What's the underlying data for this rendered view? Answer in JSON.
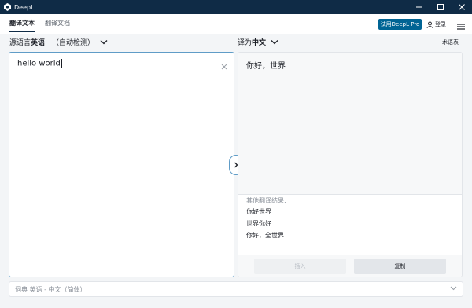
{
  "window": {
    "title": "DeepL",
    "controls": [
      "minimize-icon",
      "maximize-icon",
      "close-icon"
    ]
  },
  "tabs": [
    {
      "label": "翻译文本",
      "active": true
    },
    {
      "label": "翻译文档",
      "active": false
    }
  ],
  "header": {
    "pro_button": "试用DeepL Pro",
    "login": "登录",
    "accent_color": "#006494"
  },
  "source": {
    "label": "源语言",
    "language": "英语",
    "detect": "（自动检测）",
    "text": "hello world"
  },
  "target": {
    "label": "译为",
    "language": "中文",
    "glossary": "术语表",
    "text": "你好，世界",
    "alternatives_title": "其他翻译结果:",
    "alternatives": [
      "你好世界",
      "世界你好",
      "你好，全世界"
    ],
    "insert_button": "插入",
    "copy_button": "复制"
  },
  "dictionary": {
    "label": "词典 英语 - 中文（简体）"
  }
}
